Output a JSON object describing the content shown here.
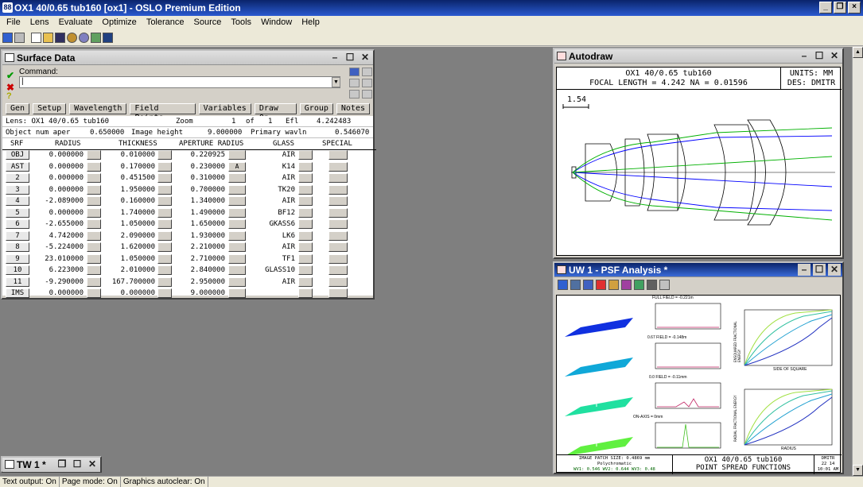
{
  "app": {
    "title": "OX1 40/0.65 tub160 [ox1] - OSLO Premium Edition",
    "icon_text": "88"
  },
  "menu": [
    "File",
    "Lens",
    "Evaluate",
    "Optimize",
    "Tolerance",
    "Source",
    "Tools",
    "Window",
    "Help"
  ],
  "surface_window": {
    "title": "Surface Data",
    "command_label": "Command:",
    "command_value": "|",
    "buttons": [
      "Gen",
      "Setup",
      "Wavelength",
      "Field Points",
      "Variables",
      "Draw On",
      "Group",
      "Notes"
    ],
    "info1": {
      "lens": "Lens: OX1 40/0.65 tub160",
      "zoom": "Zoom",
      "zoom_val": "1",
      "of": "of",
      "of_val": "1",
      "efl": "Efl",
      "efl_val": "4.242483"
    },
    "info2": {
      "obj": "Object num aper",
      "obj_val": "0.650000",
      "img": "Image height",
      "img_val": "9.000000",
      "wav": "Primary wavln",
      "wav_val": "0.546070"
    },
    "headers": {
      "srf": "SRF",
      "radius": "RADIUS",
      "thickness": "THICKNESS",
      "aperture": "APERTURE RADIUS",
      "glass": "GLASS",
      "special": "SPECIAL"
    },
    "rows": [
      {
        "srf": "OBJ",
        "radius": "0.000000",
        "thickness": "0.010000",
        "aperture": "0.220925",
        "flag": "",
        "glass": "AIR"
      },
      {
        "srf": "AST",
        "radius": "0.000000",
        "thickness": "0.170000",
        "aperture": "0.230000",
        "flag": "A",
        "glass": "K14"
      },
      {
        "srf": "2",
        "radius": "0.000000",
        "thickness": "0.451500",
        "aperture": "0.310000",
        "flag": "",
        "glass": "AIR"
      },
      {
        "srf": "3",
        "radius": "0.000000",
        "thickness": "1.950000",
        "aperture": "0.700000",
        "flag": "",
        "glass": "TK20"
      },
      {
        "srf": "4",
        "radius": "-2.089000",
        "thickness": "0.160000",
        "aperture": "1.340000",
        "flag": "",
        "glass": "AIR"
      },
      {
        "srf": "5",
        "radius": "0.000000",
        "thickness": "1.740000",
        "aperture": "1.490000",
        "flag": "",
        "glass": "BF12"
      },
      {
        "srf": "6",
        "radius": "-2.655000",
        "thickness": "1.050000",
        "aperture": "1.650000",
        "flag": "",
        "glass": "GKASS6"
      },
      {
        "srf": "7",
        "radius": "4.742000",
        "thickness": "2.090000",
        "aperture": "1.930000",
        "flag": "",
        "glass": "LK6"
      },
      {
        "srf": "8",
        "radius": "-5.224000",
        "thickness": "1.620000",
        "aperture": "2.210000",
        "flag": "",
        "glass": "AIR"
      },
      {
        "srf": "9",
        "radius": "23.010000",
        "thickness": "1.050000",
        "aperture": "2.710000",
        "flag": "",
        "glass": "TF1"
      },
      {
        "srf": "10",
        "radius": "6.223000",
        "thickness": "2.010000",
        "aperture": "2.840000",
        "flag": "",
        "glass": "GLASS10"
      },
      {
        "srf": "11",
        "radius": "-9.290000",
        "thickness": "167.700000",
        "aperture": "2.950000",
        "flag": "",
        "glass": "AIR"
      },
      {
        "srf": "IMS",
        "radius": "0.000000",
        "thickness": "0.000000",
        "aperture": "9.000000",
        "flag": "",
        "glass": ""
      }
    ]
  },
  "tw_window": {
    "title": "TW 1 *"
  },
  "autodraw": {
    "title": "Autodraw",
    "header_line1": "OX1 40/0.65 tub160",
    "header_line2": "FOCAL LENGTH = 4.242   NA = 0.01596",
    "units": "UNITS: MM",
    "des": "DES: DMITR",
    "scale": "1.54",
    "colors": {
      "ray1": "#0000ff",
      "ray2": "#00b000"
    }
  },
  "psf": {
    "title": "UW 1 - PSF Analysis *",
    "field_labels": [
      "FULL FIELD = -0.221m",
      "0.67 FIELD = -0.148m",
      "0.0 FIELD = -0.11mm",
      "ON-AXIS = 0mm"
    ],
    "surface_colors": [
      "#1030e0",
      "#10a8d8",
      "#20e0a0",
      "#60f040"
    ],
    "ee_ylabel": "ENSQUARED FRACTIONAL ENERGY",
    "ee_xlabel": "SIDE OF SQUARE",
    "rad_ylabel": "RADIAL FRACTIONAL ENERGY",
    "rad_xlabel": "RADIUS",
    "footer_left1": "IMAGE PATCH SIZE: 0.4869 mm",
    "footer_left2": "Polychromatic",
    "footer_left3": "WV1: 0.546  WV2: 0.644  WV3: 0.48",
    "footer_mid1": "OX1 40/0.65 tub160",
    "footer_mid2": "POINT SPREAD FUNCTIONS",
    "footer_right1": "DMITR",
    "footer_right2": "22  14",
    "footer_right3": "10:01 AM"
  },
  "status": [
    "Text output: On",
    "Page mode: On",
    "Graphics autoclear: On"
  ]
}
